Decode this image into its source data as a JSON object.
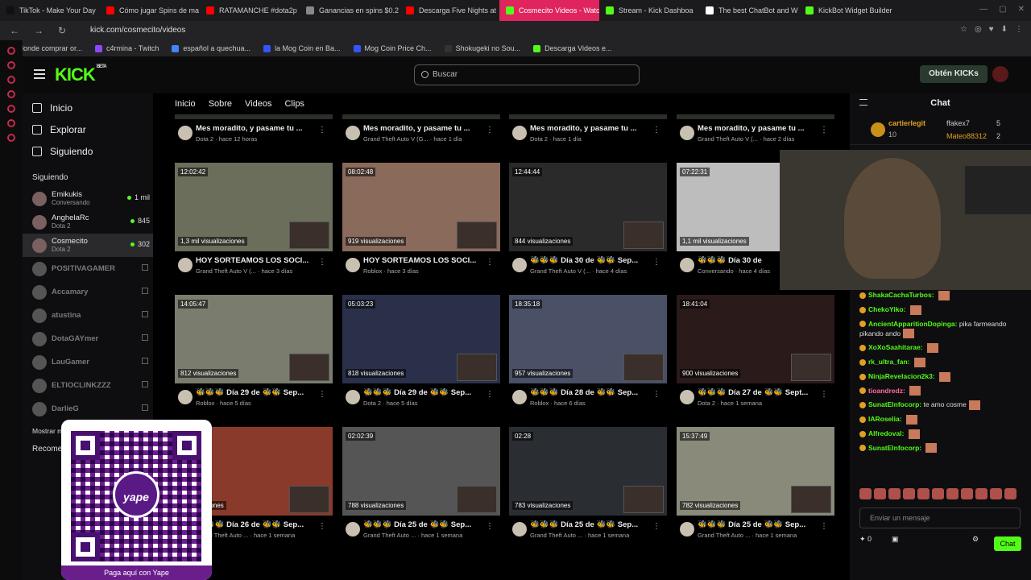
{
  "browser": {
    "tabs": [
      {
        "label": "TikTok - Make Your Day",
        "color": "#111111"
      },
      {
        "label": "Cómo jugar Spins de ma",
        "color": "#ff0000"
      },
      {
        "label": "RATAMANCHE #dota2p",
        "color": "#ff0000"
      },
      {
        "label": "Ganancias en spins $0.2",
        "color": "#888888"
      },
      {
        "label": "Descarga Five Nights at",
        "color": "#ff0000"
      },
      {
        "label": "Cosmecito Videos - Watc",
        "color": "#53fc18",
        "active": true
      },
      {
        "label": "Stream - Kick Dashboa",
        "color": "#53fc18"
      },
      {
        "label": "The best ChatBot and W",
        "color": "#ffffff"
      },
      {
        "label": "KickBot Widget Builder",
        "color": "#53fc18"
      }
    ],
    "url": "kick.com/cosmecito/videos",
    "bookmarks": [
      {
        "label": "donde comprar or...",
        "color": "#ff0000"
      },
      {
        "label": "c4rmina - Twitch",
        "color": "#9146ff"
      },
      {
        "label": "español a quechua...",
        "color": "#4285f4"
      },
      {
        "label": "la Mog Coin en Ba...",
        "color": "#3355ff"
      },
      {
        "label": "Mog Coin Price Ch...",
        "color": "#3355ff"
      },
      {
        "label": "Shokugeki no Sou...",
        "color": "#333333"
      },
      {
        "label": "Descarga Videos e...",
        "color": "#53fc18"
      }
    ]
  },
  "header": {
    "logo": "KICK",
    "logo_beta": "BETA",
    "search_placeholder": "Buscar",
    "kicks_button": "Obtén KICKs"
  },
  "sidebar": {
    "nav": [
      "Inicio",
      "Explorar",
      "Siguiendo"
    ],
    "following_title": "Siguiendo",
    "following": [
      {
        "name": "Emikukis",
        "sub": "Conversando",
        "viewers": "1 mil"
      },
      {
        "name": "AnghelaRc",
        "sub": "Dota 2",
        "viewers": "845"
      },
      {
        "name": "Cosmecito",
        "sub": "Dota 2",
        "viewers": "302"
      }
    ],
    "offline": [
      "POSITIVAGAMER",
      "Accamary",
      "atustina",
      "DotaGAYmer",
      "LauGamer",
      "ELTIOCLINKZZZ",
      "DarlieG"
    ],
    "show_more": "Mostrar m",
    "recommended_title": "Recome"
  },
  "channel_tabs": [
    "Inicio",
    "Sobre",
    "Videos",
    "Clips"
  ],
  "top_row": [
    {
      "title": "Mes moradito, y pasame tu ...",
      "sub": "Dota 2 · hace 12 horas"
    },
    {
      "title": "Mes moradito, y pasame tu ...",
      "sub": "Grand Theft Auto V (G... · hace 1 día"
    },
    {
      "title": "Mes moradito, y pasame tu ...",
      "sub": "Dota 2 · hace 1 día"
    },
    {
      "title": "Mes moradito, y pasame tu ...",
      "sub": "Grand Theft Auto V (... · hace 2 días"
    }
  ],
  "videos": [
    {
      "duration": "12:02:42",
      "views": "1,3 mil visualizaciones",
      "title": "HOY SORTEAMOS LOS SOCI...",
      "sub": "Grand Theft Auto V (... · hace 3 días",
      "tone": "#6a6e5a"
    },
    {
      "duration": "08:02:48",
      "views": "919 visualizaciones",
      "title": "HOY SORTEAMOS LOS SOCI...",
      "sub": "Roblox · hace 3 días",
      "tone": "#8a6a5a"
    },
    {
      "duration": "12:44:44",
      "views": "844 visualizaciones",
      "title": "🐝🐝🐝 Día 30 de 🐝🐝 Sep...",
      "sub": "Grand Theft Auto V (... · hace 4 días",
      "tone": "#2a2a2a"
    },
    {
      "duration": "07:22:31",
      "views": "1,1 mil visualizaciones",
      "title": "🐝🐝🐝 Día 30 de",
      "sub": "Conversando · hace 4 días",
      "tone": "#bdbdbd"
    },
    {
      "duration": "14:05:47",
      "views": "812 visualizaciones",
      "title": "🐝🐝🐝 Día 29 de 🐝🐝 Sep...",
      "sub": "Roblox · hace 5 días",
      "tone": "#7a7c6e"
    },
    {
      "duration": "05:03:23",
      "views": "818 visualizaciones",
      "title": "🐝🐝🐝 Día 29 de 🐝🐝 Sep...",
      "sub": "Dota 2 · hace 5 días",
      "tone": "#2a2f4a"
    },
    {
      "duration": "18:35:18",
      "views": "957 visualizaciones",
      "title": "🐝🐝🐝 Día 28 de 🐝🐝 Sep...",
      "sub": "Roblox · hace 6 días",
      "tone": "#4a5066"
    },
    {
      "duration": "18:41:04",
      "views": "900 visualizaciones",
      "title": "🐝🐝🐝 Día 27 de 🐝🐝 Sept...",
      "sub": "Dota 2 · hace 1 semana",
      "tone": "#2a1a1a"
    },
    {
      "duration": "",
      "views": "visualizaciones",
      "title": "🐝🐝🐝 Día 26 de 🐝🐝 Sep...",
      "sub": "Grand Theft Auto ... · hace 1 semana",
      "tone": "#8a3a2a"
    },
    {
      "duration": "02:02:39",
      "views": "788 visualizaciones",
      "title": "🐝🐝🐝 Día 25 de 🐝🐝 Sep...",
      "sub": "Grand Theft Auto ... · hace 1 semana",
      "tone": "#555555"
    },
    {
      "duration": "02:28",
      "views": "783 visualizaciones",
      "title": "🐝🐝🐝 Día 25 de 🐝🐝 Sep...",
      "sub": "Grand Theft Auto ... · hace 1 semana",
      "tone": "#2a2e33"
    },
    {
      "duration": "15:37:49",
      "views": "782 visualizaciones",
      "title": "🐝🐝🐝 Día 25 de 🐝🐝 Sep...",
      "sub": "Grand Theft Auto ... · hace 1 semana",
      "tone": "#8a8a7a"
    }
  ],
  "chat": {
    "title": "Chat",
    "top_users": [
      {
        "name": "cartierlegit",
        "count": "10"
      },
      {
        "name": "ffakex7",
        "count": "5"
      },
      {
        "name": "Mateo88312",
        "count": "2"
      }
    ],
    "messages": [
      {
        "user": "ShakaCachaTurbos:",
        "text": "",
        "color": "#53fc18"
      },
      {
        "user": "ChekoYiko:",
        "text": "",
        "color": "#53fc18"
      },
      {
        "user": "AncientApparitionDopinga:",
        "text": "pika farmeando pikando ando",
        "color": "#53fc18"
      },
      {
        "user": "XoXoSaahitarae:",
        "text": "",
        "color": "#53fc18"
      },
      {
        "user": "rk_ultra_fan:",
        "text": "",
        "color": "#53fc18"
      },
      {
        "user": "NinjaRevelacion2k3:",
        "text": "",
        "color": "#53fc18"
      },
      {
        "user": "tioandredz:",
        "text": "",
        "color": "#ff6b9a"
      },
      {
        "user": "SunatElnfocorp:",
        "text": "te amo cosme",
        "color": "#53fc18"
      },
      {
        "user": "IARoselia:",
        "text": "",
        "color": "#53fc18"
      },
      {
        "user": "Alfredoval:",
        "text": "",
        "color": "#53fc18"
      },
      {
        "user": "SunatElnfocorp:",
        "text": "",
        "color": "#53fc18"
      }
    ],
    "input_placeholder": "Enviar un mensaje",
    "points": "0",
    "send_button": "Chat"
  },
  "overlay": {
    "qr_brand": "yape",
    "qr_button": "Paga aquí con Yape"
  },
  "colors": {
    "accent": "#53fc18",
    "bg": "#0b0b0c",
    "yape": "#6a1e8c"
  }
}
